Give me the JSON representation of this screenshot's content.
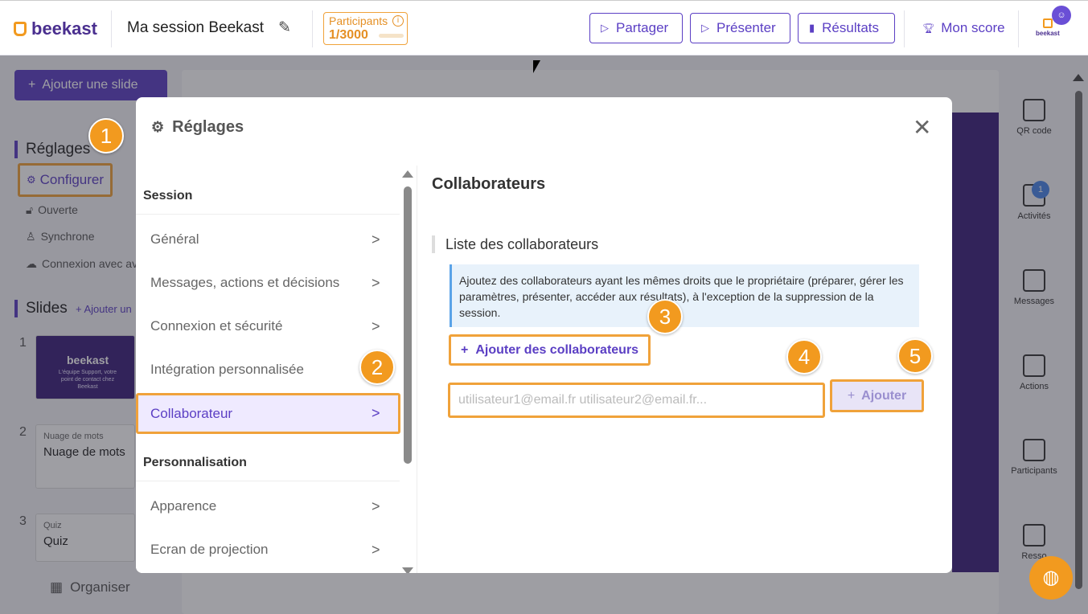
{
  "app": {
    "logo_text": "beekast",
    "session_title": "Ma session Beekast",
    "participants_label": "Participants",
    "participants_count": "1/3000",
    "participants_progress": 0.0003,
    "brand_corner": "beekast"
  },
  "toolbar": {
    "share_label": "Partager",
    "present_label": "Présenter",
    "results_label": "Résultats",
    "score_label": "Mon score"
  },
  "left_panel": {
    "add_slide_label": "Ajouter une slide",
    "settings_heading": "Réglages",
    "configure_label": "Configurer",
    "items": [
      "Ouverte",
      "Synchrone",
      "Connexion avec av"
    ],
    "slides_heading": "Slides",
    "slides_add_label": "Ajouter un",
    "slides": [
      {
        "num": "1",
        "type": "",
        "name": "beekast"
      },
      {
        "num": "2",
        "type": "Nuage de mots",
        "name": "Nuage de mots"
      },
      {
        "num": "3",
        "type": "Quiz",
        "name": "Quiz"
      }
    ],
    "slide1_caption": "L'équipe Support, votre point de contact chez Beekast",
    "organise_label": "Organiser"
  },
  "right_rail": {
    "items": [
      "QR code",
      "Activités",
      "Messages",
      "Actions",
      "Participants",
      "Resso"
    ],
    "activities_badge": "1"
  },
  "modal": {
    "title": "Réglages",
    "nav": {
      "session_heading": "Session",
      "items": [
        "Général",
        "Messages, actions et décisions",
        "Connexion et sécurité",
        "Intégration personnalisée",
        "Collaborateur"
      ],
      "personalisation_heading": "Personnalisation",
      "items2": [
        "Apparence",
        "Ecran de projection"
      ]
    },
    "content": {
      "title": "Collaborateurs",
      "subsection": "Liste des collaborateurs",
      "info": "Ajoutez des collaborateurs ayant les mêmes droits que le propriétaire (préparer, gérer les paramètres, présenter, accéder aux résultats), à l'exception de la suppression de la session.",
      "add_collaborators_label": "Ajouter des collaborateurs",
      "email_placeholder": "utilisateur1@email.fr utilisateur2@email.fr...",
      "email_value": "",
      "add_button_label": "Ajouter"
    }
  },
  "markers": [
    "1",
    "2",
    "3",
    "4",
    "5"
  ],
  "colors": {
    "primary": "#5b3fc4",
    "accent": "#f29a1f",
    "highlight": "#f0a23a",
    "info_bg": "#e8f2fb"
  }
}
